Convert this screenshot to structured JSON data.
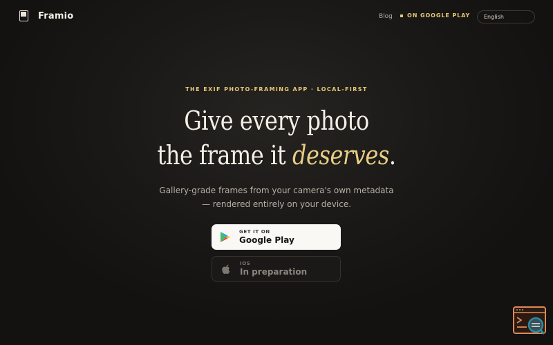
{
  "brand": {
    "name": "Framio"
  },
  "nav": {
    "blog": "Blog",
    "google_play": "ON GOOGLE PLAY",
    "language": "English"
  },
  "hero": {
    "eyebrow": "THE EXIF PHOTO-FRAMING APP · LOCAL-FIRST",
    "title_line1": "Give every photo",
    "title_line2_prefix": "the frame it ",
    "title_accent": "deserves",
    "title_end": ".",
    "subtitle_line1": "Gallery-grade frames from your camera's own metadata",
    "subtitle_line2": "— rendered entirely on your device."
  },
  "cta": {
    "play_small": "GET IT ON",
    "play_big": "Google Play",
    "ios_small": "IOS",
    "ios_big": "In preparation"
  },
  "colors": {
    "background": "#141312",
    "accent_gold": "#e6c879",
    "text_primary": "#f3efe6",
    "text_muted": "#b6afa4",
    "widget_orange": "#e08a55"
  },
  "icons": {
    "logo": "photo-frame-icon",
    "play": "google-play-icon",
    "ios": "apple-icon",
    "widget": "terminal-search-icon"
  }
}
